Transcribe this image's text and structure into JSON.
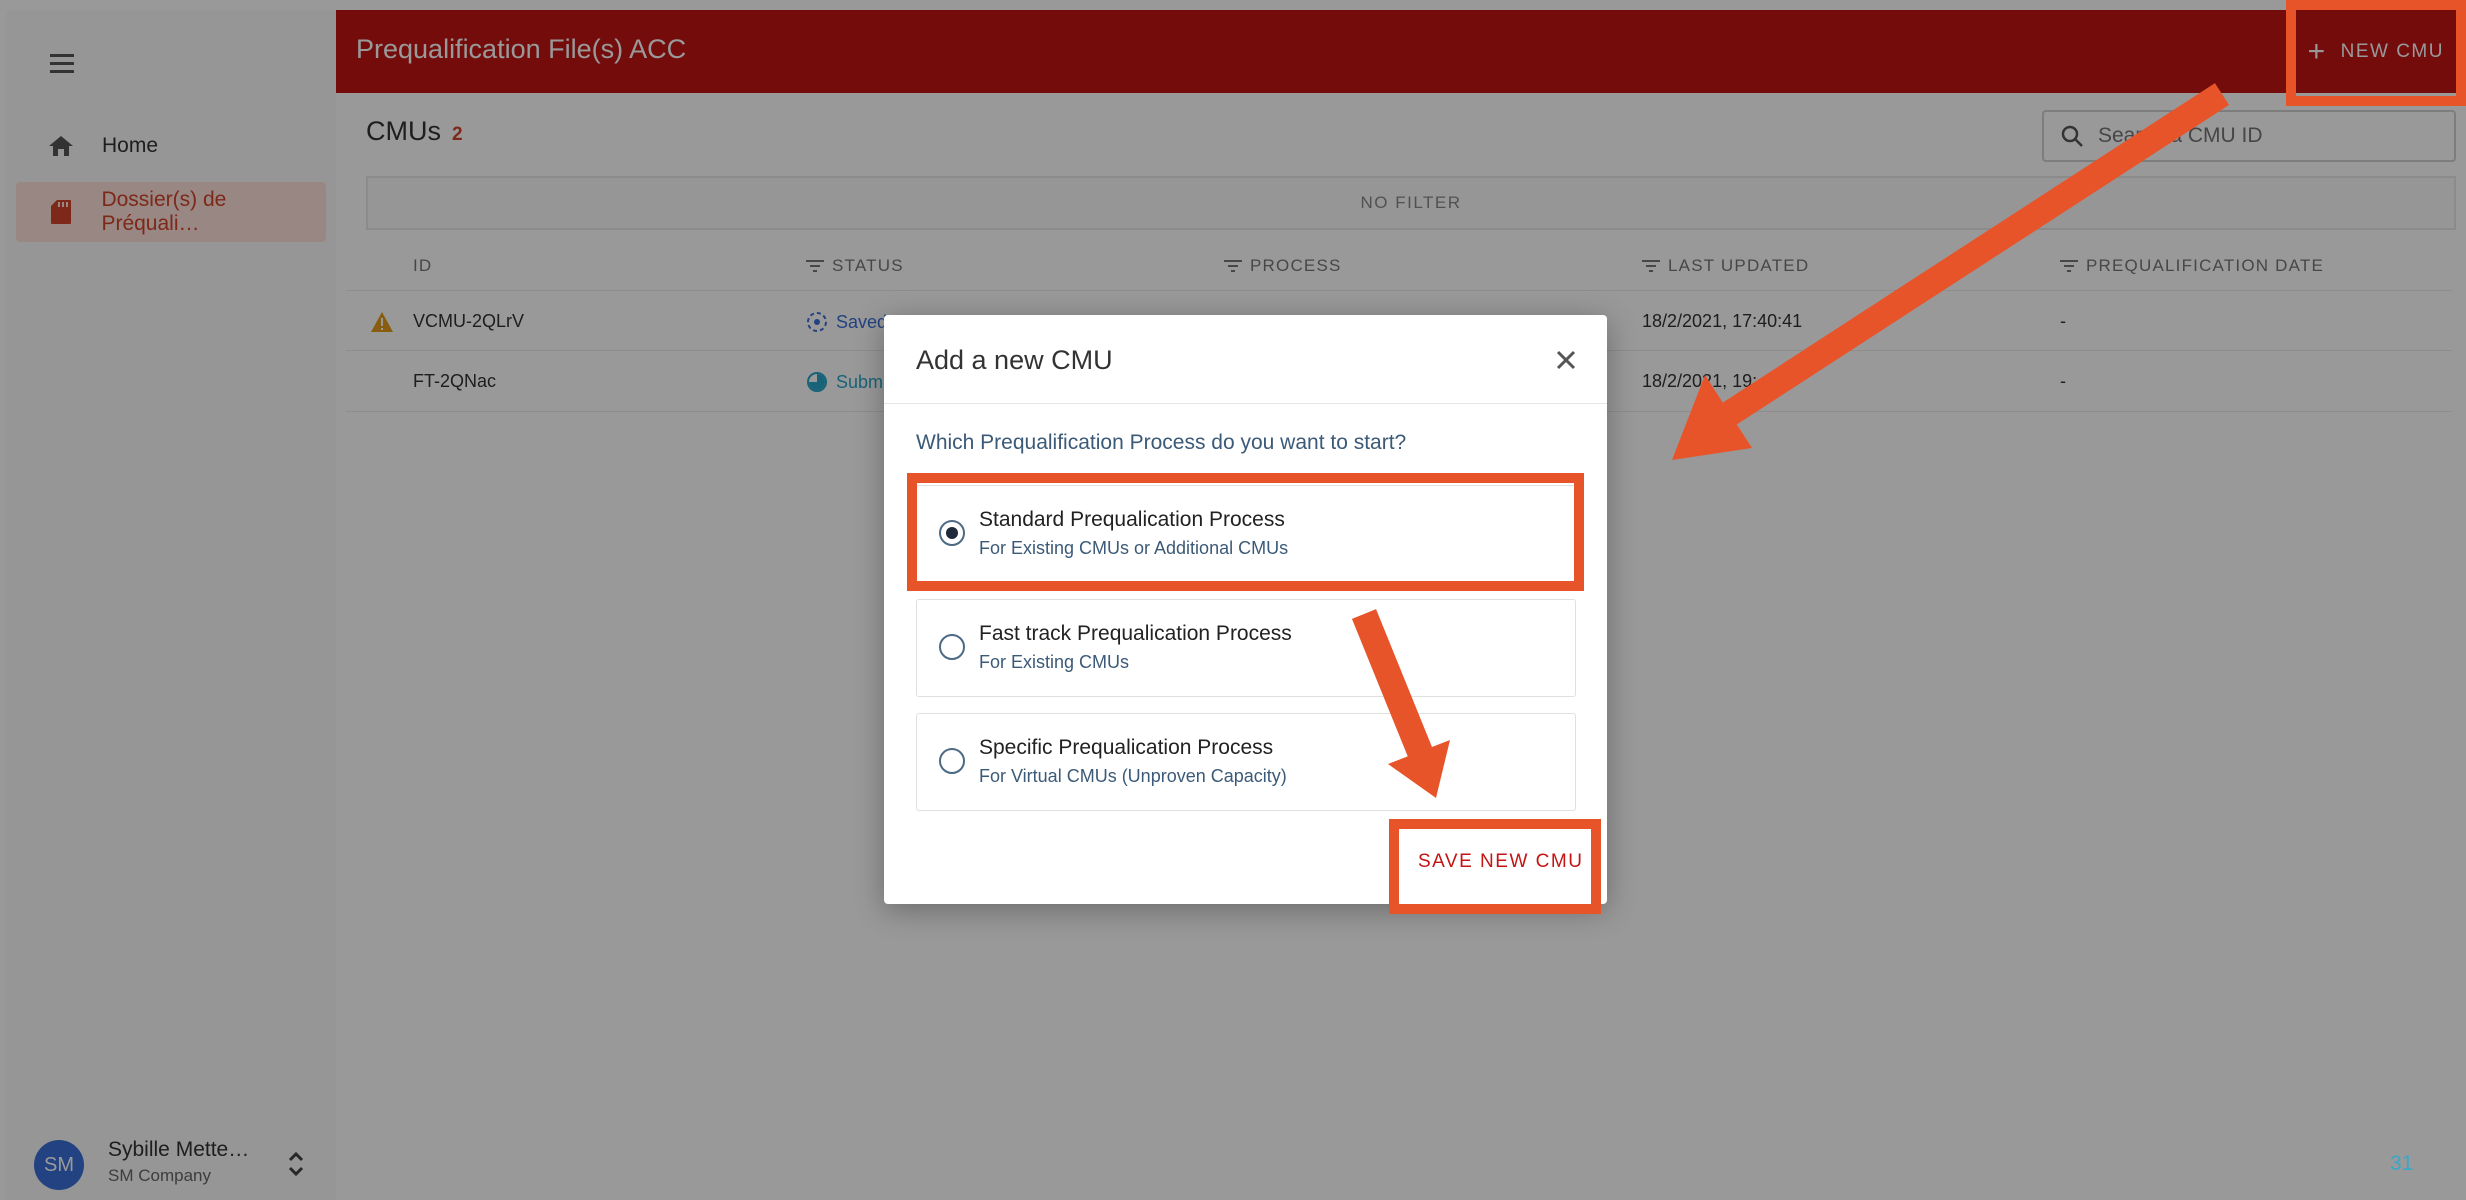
{
  "sidebar": {
    "items": [
      {
        "label": "Home",
        "icon": "home-icon"
      },
      {
        "label": "Dossier(s) de Préquali…",
        "icon": "folder-icon"
      }
    ],
    "user": {
      "initials": "SM",
      "name": "Sybille Mette…",
      "company": "SM Company"
    }
  },
  "header": {
    "title": "Prequalification File(s) ACC",
    "new_cmu_label": "NEW CMU",
    "new_cmu_icon": "+"
  },
  "main": {
    "title": "CMUs",
    "count": "2",
    "search": {
      "placeholder": "Search a CMU ID",
      "value": "Search a CMU ID"
    },
    "filter_label": "NO FILTER",
    "columns": [
      "ID",
      "STATUS",
      "PROCESS",
      "LAST UPDATED",
      "PREQUALIFICATION DATE"
    ],
    "rows": [
      {
        "id": "VCMU-2QLrV",
        "status": "Saved",
        "last_updated": "18/2/2021, 17:40:41",
        "prequal_date": "-",
        "warning": true
      },
      {
        "id": "FT-2QNac",
        "status": "Subm",
        "last_updated": "18/2/2021, 19:",
        "prequal_date": "-",
        "warning": false
      }
    ]
  },
  "modal": {
    "title": "Add a new CMU",
    "question": "Which Prequalification Process do you want to start?",
    "options": [
      {
        "title": "Standard Prequalication Process",
        "subtitle": "For Existing CMUs or Additional CMUs",
        "selected": true
      },
      {
        "title": "Fast track Prequalication Process",
        "subtitle": "For Existing CMUs",
        "selected": false
      },
      {
        "title": "Specific Prequalication Process",
        "subtitle": "For Virtual CMUs (Unproven Capacity)",
        "selected": false
      }
    ],
    "save_label": "SAVE NEW CMU"
  },
  "page_number": "31",
  "colors": {
    "brand_red": "#c41414",
    "annotation_orange": "#e8542a",
    "accent_blue": "#3a6fd8"
  }
}
